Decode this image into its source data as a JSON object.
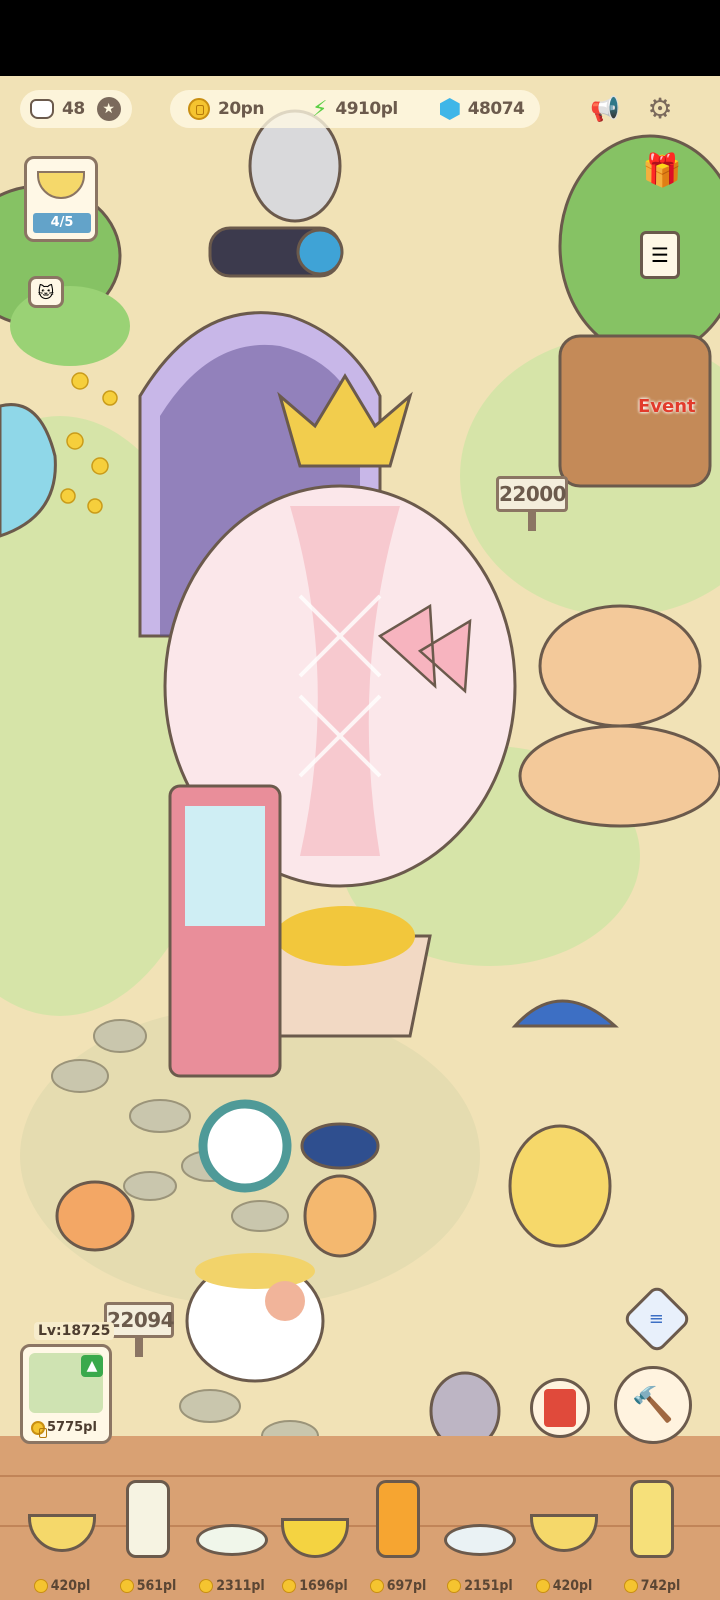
{
  "hud": {
    "cats": "48",
    "coins": "20pn",
    "energy": "4910pl",
    "gems": "48074"
  },
  "side": {
    "recipe_progress": "4/5",
    "event_label": "Event"
  },
  "signs": {
    "top_sign": "22000",
    "bottom_sign": "22094"
  },
  "level_card": {
    "level": "Lv:18725",
    "price": "5775pl"
  },
  "foods": [
    {
      "name": "soup-bowl",
      "price": "420pl"
    },
    {
      "name": "milk-jar",
      "price": "561pl"
    },
    {
      "name": "salad-plate",
      "price": "2311pl"
    },
    {
      "name": "omelette-bowl",
      "price": "1696pl"
    },
    {
      "name": "juice-jar",
      "price": "697pl"
    },
    {
      "name": "bean-plate",
      "price": "2151pl"
    },
    {
      "name": "soup-bowl-2",
      "price": "420pl"
    },
    {
      "name": "lemon-jar",
      "price": "742pl"
    }
  ],
  "colors": {
    "ground": "#f1e2b6",
    "grass": "#cde0a3",
    "outline": "#6b5a4c",
    "balloon_pink": "#f7c9cf",
    "coin": "#f5c430",
    "gem": "#3fb6e8",
    "energy": "#5ccf45"
  }
}
